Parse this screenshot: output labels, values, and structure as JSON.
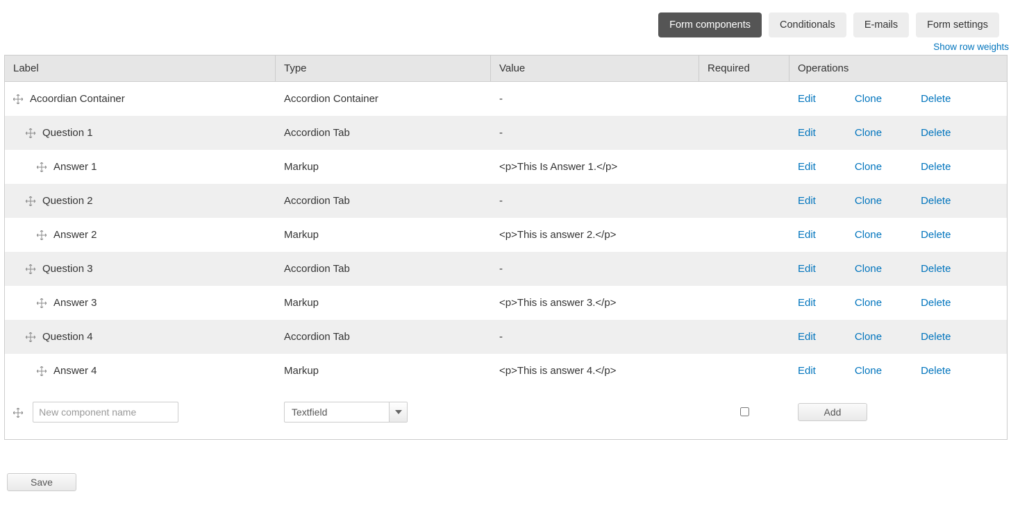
{
  "tabs": {
    "form_components": "Form components",
    "conditionals": "Conditionals",
    "emails": "E-mails",
    "form_settings": "Form settings"
  },
  "show_weights": "Show row weights",
  "columns": {
    "label": "Label",
    "type": "Type",
    "value": "Value",
    "required": "Required",
    "operations": "Operations"
  },
  "ops": {
    "edit": "Edit",
    "clone": "Clone",
    "delete": "Delete"
  },
  "rows": [
    {
      "label": "Acoordian Container",
      "type": "Accordion Container",
      "value": "-",
      "indent": 0,
      "shaded": false
    },
    {
      "label": "Question 1",
      "type": "Accordion Tab",
      "value": "-",
      "indent": 1,
      "shaded": true
    },
    {
      "label": "Answer 1",
      "type": "Markup",
      "value": "<p>This Is Answer 1.</p>",
      "indent": 2,
      "shaded": false
    },
    {
      "label": "Question 2",
      "type": "Accordion Tab",
      "value": "-",
      "indent": 1,
      "shaded": true
    },
    {
      "label": "Answer 2",
      "type": "Markup",
      "value": "<p>This is answer 2.</p>",
      "indent": 2,
      "shaded": false
    },
    {
      "label": "Question 3",
      "type": "Accordion Tab",
      "value": "-",
      "indent": 1,
      "shaded": true
    },
    {
      "label": "Answer 3",
      "type": "Markup",
      "value": "<p>This is answer 3.</p>",
      "indent": 2,
      "shaded": false
    },
    {
      "label": "Question 4",
      "type": "Accordion Tab",
      "value": "-",
      "indent": 1,
      "shaded": true
    },
    {
      "label": "Answer 4",
      "type": "Markup",
      "value": "<p>This is answer 4.</p>",
      "indent": 2,
      "shaded": false
    }
  ],
  "new_row": {
    "placeholder": "New component name",
    "type_selected": "Textfield",
    "add_label": "Add"
  },
  "save_label": "Save"
}
